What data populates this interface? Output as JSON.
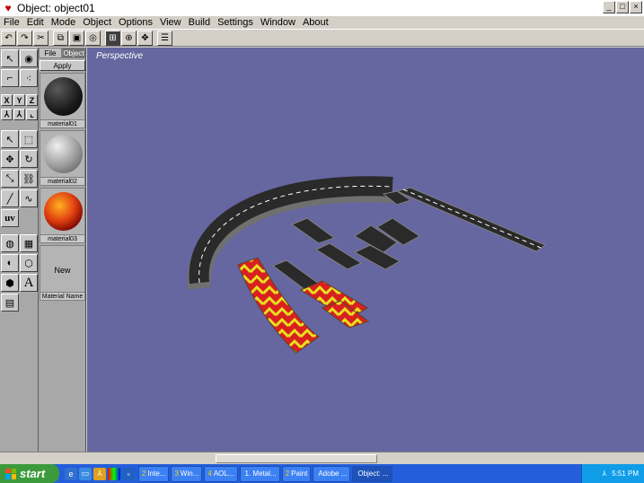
{
  "window": {
    "title": "Object: object01",
    "buttons": {
      "minimize": "_",
      "maximize": "□",
      "close": "×"
    }
  },
  "menu": [
    "File",
    "Edit",
    "Mode",
    "Object",
    "Options",
    "View",
    "Build",
    "Settings",
    "Window",
    "About"
  ],
  "toolbar_icons": [
    "undo-icon",
    "redo-icon",
    "cut-icon",
    "copy-icon",
    "paste-icon",
    "grid-icon",
    "select-all-icon",
    "target-icon",
    "move-icon",
    "list-icon"
  ],
  "material_panel": {
    "tabs": [
      "File",
      "Object"
    ],
    "active_tab": "Object",
    "apply_label": "Apply",
    "materials": [
      {
        "name": "material01",
        "color": "#1a1a1a"
      },
      {
        "name": "material02",
        "color": "#9a9a9a"
      },
      {
        "name": "material03",
        "color": "#c83010"
      }
    ],
    "new_label": "New",
    "name_label": "Material Name"
  },
  "tools": {
    "axis_labels": [
      "X",
      "Y",
      "Z"
    ],
    "uv_label": "uv",
    "text_label": "A"
  },
  "viewport": {
    "label": "Perspective",
    "background": "#6666a0"
  },
  "taskbar": {
    "start_label": "start",
    "tasks": [
      {
        "num": "2",
        "label": "Inte..."
      },
      {
        "num": "3",
        "label": "Win..."
      },
      {
        "num": "4",
        "label": "AOL..."
      },
      {
        "num": "",
        "label": "1. Metal..."
      },
      {
        "num": "2",
        "label": "Paint"
      },
      {
        "num": "",
        "label": "Adobe ..."
      },
      {
        "num": "",
        "label": "Object: ..."
      }
    ],
    "clock": "5:51 PM"
  }
}
